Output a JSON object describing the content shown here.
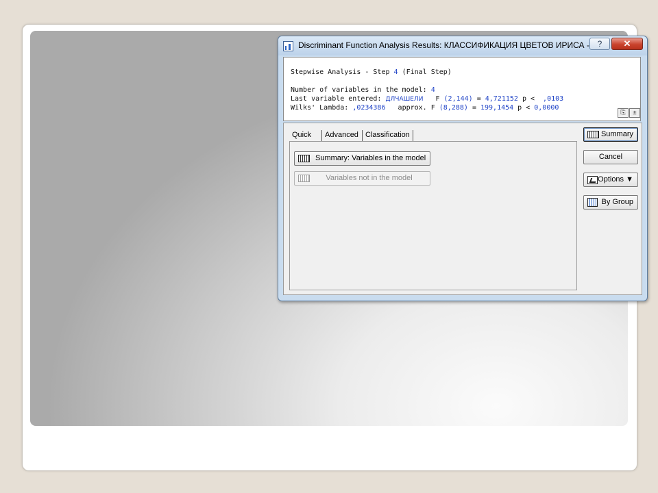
{
  "window": {
    "title": "Discriminant Function Analysis Results: КЛАССИФИКАЦИЯ ЦВЕТОВ ИРИСА - ...",
    "help_label": "?",
    "close_label": "✕"
  },
  "results": {
    "line1_prefix": "Stepwise Analysis - Step ",
    "step": "4",
    "line1_suffix": " (Final Step)",
    "line2_prefix": "Number of variables in the model: ",
    "n_vars": "4",
    "line3_prefix": "Last variable entered: ",
    "last_var": "ДЛЧАШЕЛИ",
    "f_label_3": "   F ",
    "f_df_3": "(2,144)",
    "eq_3": " = ",
    "f_val_3": "4,721152",
    "p_label_3": " p < ",
    "p_val_3": " ,0103",
    "line4_prefix": "Wilks' Lambda: ",
    "lambda_val": ",0234386",
    "approx_label": "   approx. F ",
    "f_df_4": "(8,288)",
    "eq_4": " = ",
    "f_val_4": "199,1454",
    "p_label_4": " p < ",
    "p_val_4": "0,0000"
  },
  "tabs": [
    "Quick",
    "Advanced",
    "Classification"
  ],
  "quick": {
    "summary_button": "Summary:  Variables in the model",
    "not_in_model_button": "Variables not in the model"
  },
  "side": {
    "summary": "Summary",
    "cancel": "Cancel",
    "options": "Options ▼",
    "by_group": "By Group"
  }
}
